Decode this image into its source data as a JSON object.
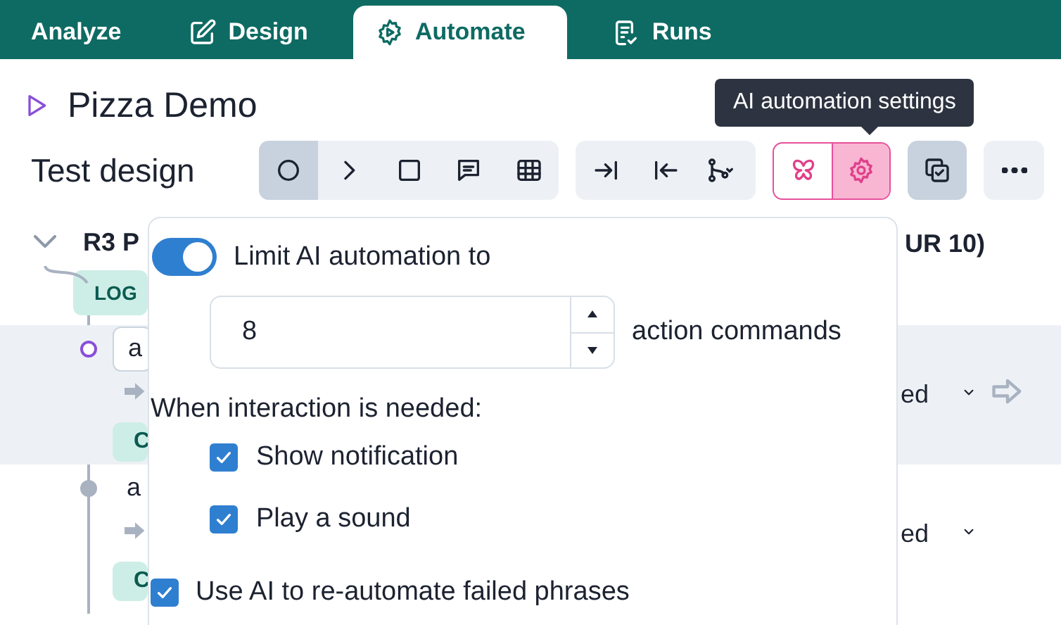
{
  "tabs": [
    {
      "label": "Analyze",
      "selected": false
    },
    {
      "label": "Design",
      "selected": false
    },
    {
      "label": "Automate",
      "selected": true
    },
    {
      "label": "Runs",
      "selected": false
    }
  ],
  "title": "Pizza Demo",
  "tooltip": "AI automation settings",
  "toolbar": {
    "label": "Test design",
    "groups": [
      {
        "kind": "plain",
        "buttons": [
          {
            "selected": true
          },
          {
            "selected": false
          },
          {
            "selected": false
          },
          {
            "selected": false
          },
          {
            "selected": false
          }
        ]
      },
      {
        "kind": "plain",
        "buttons": [
          {
            "selected": false
          },
          {
            "selected": false
          },
          {
            "selected": false
          }
        ]
      },
      {
        "kind": "ai",
        "buttons": [
          {
            "selected": false
          },
          {
            "selected": true
          }
        ]
      },
      {
        "kind": "plain",
        "buttons": [
          {
            "selected": true
          }
        ]
      },
      {
        "kind": "plain",
        "buttons": [
          {
            "selected": false
          }
        ]
      }
    ]
  },
  "scenario": {
    "name": "R3 P",
    "name_end": "UR 10)",
    "tag": "LOG",
    "steps": [
      {
        "text": "a",
        "selected": true,
        "tag": "C",
        "status": "ed"
      },
      {
        "text": "a",
        "selected": false,
        "tag": "C",
        "status": "ed"
      }
    ]
  },
  "popup": {
    "limit": {
      "on": true,
      "label": "Limit AI automation to"
    },
    "count": {
      "value": "8",
      "unit": "action commands"
    },
    "interaction_label": "When interaction is needed:",
    "options": [
      {
        "label": "Show notification",
        "checked": true
      },
      {
        "label": "Play a sound",
        "checked": true
      }
    ],
    "reautomate": {
      "label": "Use AI to re-automate failed phrases",
      "checked": true
    }
  }
}
